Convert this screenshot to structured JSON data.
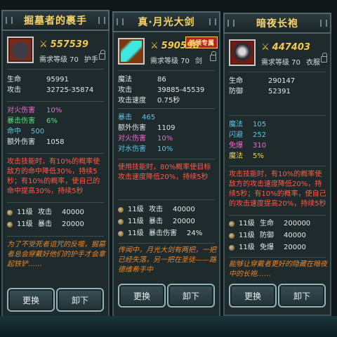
{
  "cards": [
    {
      "title": "掘墓者的裹手",
      "exclusive": "",
      "power": "557539",
      "req": "需求等级 70",
      "slot": "护手",
      "stats": [
        {
          "k": "生命",
          "v": "95991",
          "color": "white"
        },
        {
          "k": "攻击",
          "v": "32725-35874",
          "color": "white"
        }
      ],
      "stats2": [
        {
          "k": "对火伤害",
          "v": "10%",
          "color": "pink"
        },
        {
          "k": "暴击伤害",
          "v": "6%",
          "color": "green"
        },
        {
          "k": "命中",
          "v": "500",
          "color": "blue"
        },
        {
          "k": "额外伤害",
          "v": "1058",
          "color": "white"
        }
      ],
      "skill": "攻击技能时，有10%的概率使敌方的命中降低30%，持续5秒；有10%的概率，使自己的命中提高30%，持续5秒",
      "levels": [
        {
          "lv": "11级",
          "st": "攻击",
          "val": "40000"
        },
        {
          "lv": "11级",
          "st": "暴击",
          "val": "20000"
        }
      ],
      "flavor": "为了不受死者诅咒的反噬，掘墓者总会穿戴好他们的护手才会拿起铁铲……",
      "btn_change": "更换",
      "btn_remove": "卸下"
    },
    {
      "title": "真·月光大剑",
      "exclusive": "首领专属",
      "power": "590598",
      "req": "需求等级 70",
      "slot": "剑",
      "stats": [
        {
          "k": "魔法",
          "v": "86",
          "color": "white"
        },
        {
          "k": "攻击",
          "v": "39885-45539",
          "color": "white"
        },
        {
          "k": "攻击速度",
          "v": "0.75秒",
          "color": "white"
        }
      ],
      "stats2": [
        {
          "k": "暴击",
          "v": "465",
          "color": "blue"
        },
        {
          "k": "额外伤害",
          "v": "1109",
          "color": "white"
        },
        {
          "k": "对火伤害",
          "v": "10%",
          "color": "pink"
        },
        {
          "k": "对水伤害",
          "v": "10%",
          "color": "blue"
        }
      ],
      "skill": "使用技能时，80%概率使目标攻击速度降低20%，持续5秒",
      "levels": [
        {
          "lv": "11级",
          "st": "攻击",
          "val": "40000"
        },
        {
          "lv": "11级",
          "st": "暴击",
          "val": "20000"
        },
        {
          "lv": "11级",
          "st": "暴击伤害",
          "val": "24%"
        }
      ],
      "flavor": "传闻中，月光大剑有两把，一把已经失落，另一把在圣徒——路德维希手中",
      "btn_change": "更换",
      "btn_remove": "卸下"
    },
    {
      "title": "暗夜长袍",
      "exclusive": "",
      "power": "447403",
      "req": "需求等级 70",
      "slot": "衣服",
      "stats": [
        {
          "k": "生命",
          "v": "290147",
          "color": "white"
        },
        {
          "k": "防御",
          "v": "52391",
          "color": "white"
        }
      ],
      "stats2": [
        {
          "k": "魔法",
          "v": "105",
          "color": "blue"
        },
        {
          "k": "闪避",
          "v": "252",
          "color": "blue"
        },
        {
          "k": "免爆",
          "v": "310",
          "color": "pink"
        },
        {
          "k": "魔法",
          "v": "5%",
          "color": "yellow"
        }
      ],
      "skill": "攻击技能时，有10%的概率使敌方的攻击速度降低20%，持续5秒；有10%的概率，使自己的攻击速度提高20%，持续5秒",
      "levels": [
        {
          "lv": "11级",
          "st": "生命",
          "val": "200000"
        },
        {
          "lv": "11级",
          "st": "防御",
          "val": "40000"
        },
        {
          "lv": "11级",
          "st": "免爆",
          "val": "20000"
        }
      ],
      "flavor": "能够让穿戴者更好的隐藏在暗夜中的长袍……",
      "btn_change": "更换",
      "btn_remove": "卸下"
    }
  ]
}
